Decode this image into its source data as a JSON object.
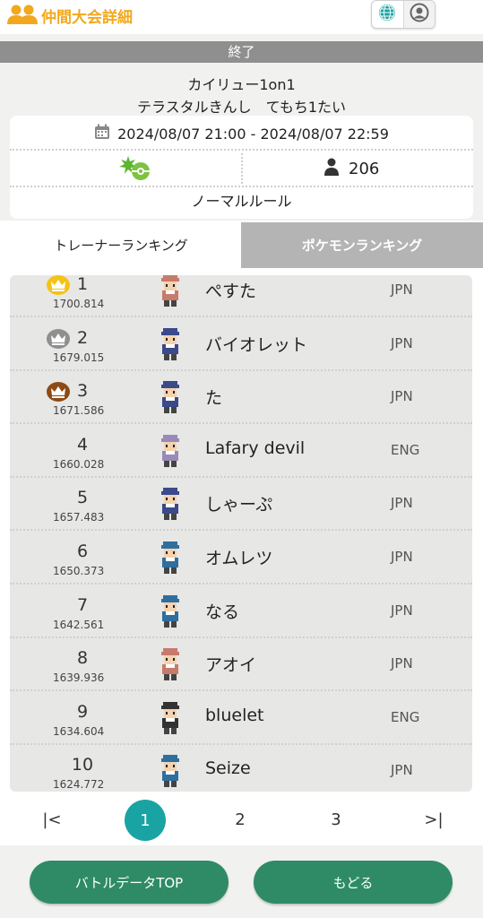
{
  "header": {
    "title": "仲間大会詳細",
    "people_icon": "people-icon",
    "globe_icon": "globe-icon",
    "account_icon": "account-icon",
    "accent_color": "#f2a81d"
  },
  "event": {
    "status": "終了",
    "name": "カイリュー1on1",
    "subtitle": "テラスタルきんし　てもち1たい",
    "date_range": "2024/08/07 21:00 - 2024/08/07 22:59",
    "participant_count": "206",
    "rule": "ノーマルルール"
  },
  "tabs": {
    "trainer": "トレーナーランキング",
    "pokemon": "ポケモンランキング"
  },
  "rankings": [
    {
      "rank": "1",
      "score": "1700.814",
      "name": "ぺすた",
      "region": "JPN",
      "crown": "gold",
      "avatar_color": "#c77b6b"
    },
    {
      "rank": "2",
      "score": "1679.015",
      "name": "バイオレット",
      "region": "JPN",
      "crown": "silver",
      "avatar_color": "#3a4a8a"
    },
    {
      "rank": "3",
      "score": "1671.586",
      "name": "た",
      "region": "JPN",
      "crown": "bronze",
      "avatar_color": "#3a4a8a"
    },
    {
      "rank": "4",
      "score": "1660.028",
      "name": "Lafary devil",
      "region": "ENG",
      "crown": "",
      "avatar_color": "#9a8ab8"
    },
    {
      "rank": "5",
      "score": "1657.483",
      "name": "しゃーぷ",
      "region": "JPN",
      "crown": "",
      "avatar_color": "#3a4a8a"
    },
    {
      "rank": "6",
      "score": "1650.373",
      "name": "オムレツ",
      "region": "JPN",
      "crown": "",
      "avatar_color": "#2f6f9f"
    },
    {
      "rank": "7",
      "score": "1642.561",
      "name": "なる",
      "region": "JPN",
      "crown": "",
      "avatar_color": "#2f6f9f"
    },
    {
      "rank": "8",
      "score": "1639.936",
      "name": "アオイ",
      "region": "JPN",
      "crown": "",
      "avatar_color": "#c77b6b"
    },
    {
      "rank": "9",
      "score": "1634.604",
      "name": "bluelet",
      "region": "ENG",
      "crown": "",
      "avatar_color": "#333333"
    },
    {
      "rank": "10",
      "score": "1624.772",
      "name": "Seize",
      "region": "JPN",
      "crown": "",
      "avatar_color": "#2f6f9f"
    }
  ],
  "pager": {
    "first": "|<",
    "pages": [
      "1",
      "2",
      "3"
    ],
    "last": ">|",
    "current": "1"
  },
  "footer": {
    "battle_top": "バトルデータTOP",
    "back": "もどる",
    "button_color": "#2e8b66"
  }
}
